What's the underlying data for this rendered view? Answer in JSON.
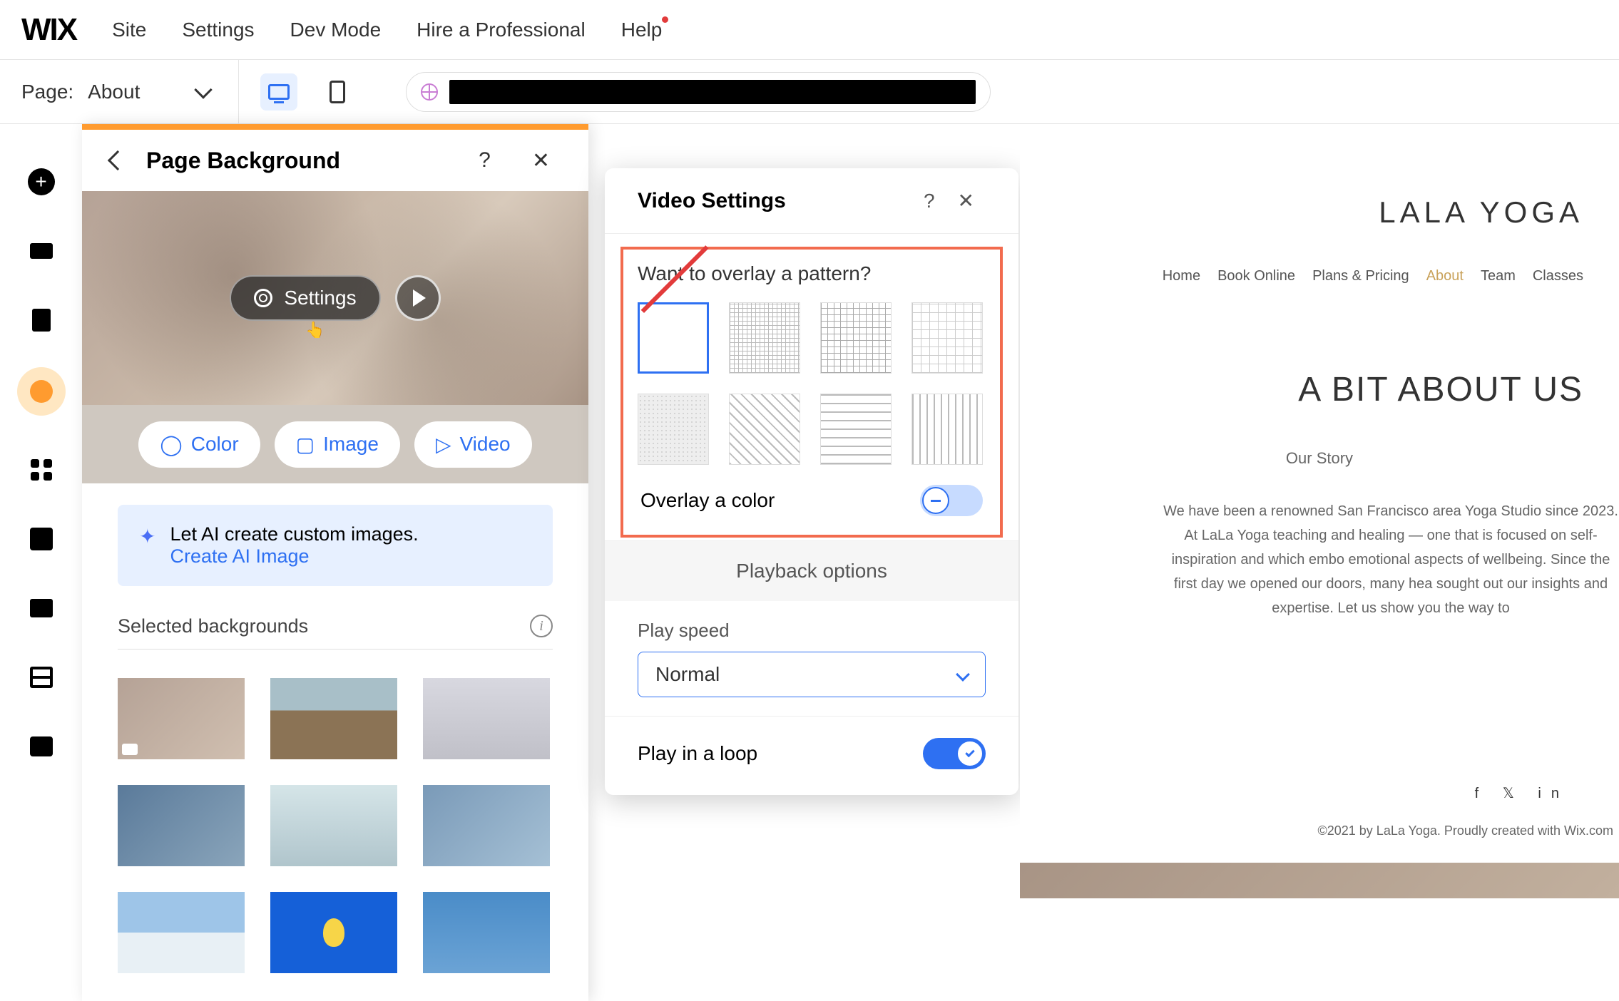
{
  "topmenu": {
    "site": "Site",
    "settings": "Settings",
    "devmode": "Dev Mode",
    "hire": "Hire a Professional",
    "help": "Help"
  },
  "secondbar": {
    "page_label": "Page:",
    "page_name": "About"
  },
  "pb": {
    "title": "Page Background",
    "settings_btn": "Settings",
    "tab_color": "Color",
    "tab_image": "Image",
    "tab_video": "Video",
    "ai_text": "Let AI create custom images.",
    "ai_link": "Create AI Image",
    "section_title": "Selected backgrounds"
  },
  "vs": {
    "title": "Video Settings",
    "pattern_q": "Want to overlay a pattern?",
    "overlay_color": "Overlay a color",
    "playback": "Playback options",
    "speed_label": "Play speed",
    "speed_value": "Normal",
    "loop": "Play in a loop"
  },
  "site": {
    "title": "LALA YOGA",
    "nav": {
      "home": "Home",
      "book": "Book Online",
      "plans": "Plans & Pricing",
      "about": "About",
      "team": "Team",
      "classes": "Classes"
    },
    "heading": "A BIT ABOUT US",
    "sub": "Our Story",
    "body": "We have been a renowned San Francisco area Yoga Studio since 2023. At LaLa Yoga teaching and healing — one that is focused on self-inspiration and which embo emotional aspects of wellbeing. Since the first day we opened our doors, many hea sought out our insights and expertise. Let us show you the way to",
    "footer": "©2021 by LaLa Yoga. Proudly created with Wix.com"
  }
}
